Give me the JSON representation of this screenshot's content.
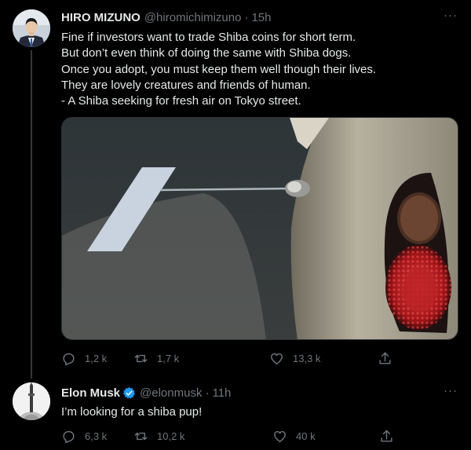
{
  "tweets": [
    {
      "author_name": "HIRO MIZUNO",
      "handle": "@hiromichimizuno",
      "separator": "·",
      "time": "15h",
      "text_lines": [
        "Fine if investors want to trade Shiba coins for short term.",
        "But don’t even think of doing the same with Shiba dogs.",
        "Once you adopt, you must keep them well though their lives.",
        "They are lovely creatures and friends of human.",
        "- A Shiba seeking for fresh air on Tokyo street."
      ],
      "more_label": "···",
      "stats": {
        "replies": "1,2 k",
        "retweets": "1,7 k",
        "likes": "13,3 k"
      }
    },
    {
      "author_name": "Elon Musk",
      "handle": "@elonmusk",
      "separator": "·",
      "time": "11h",
      "text": "I’m looking for a shiba pup!",
      "more_label": "···",
      "stats": {
        "replies": "6,3 k",
        "retweets": "10,2 k",
        "likes": "40 k"
      }
    }
  ],
  "colors": {
    "background": "#000000",
    "primary_text": "#e7e9ea",
    "secondary_text": "#71767b",
    "verified_blue": "#1d9bf0",
    "thread_line": "#333639"
  },
  "icons": [
    "reply-icon",
    "retweet-icon",
    "like-icon",
    "share-icon",
    "verified-badge-icon",
    "more-icon"
  ]
}
